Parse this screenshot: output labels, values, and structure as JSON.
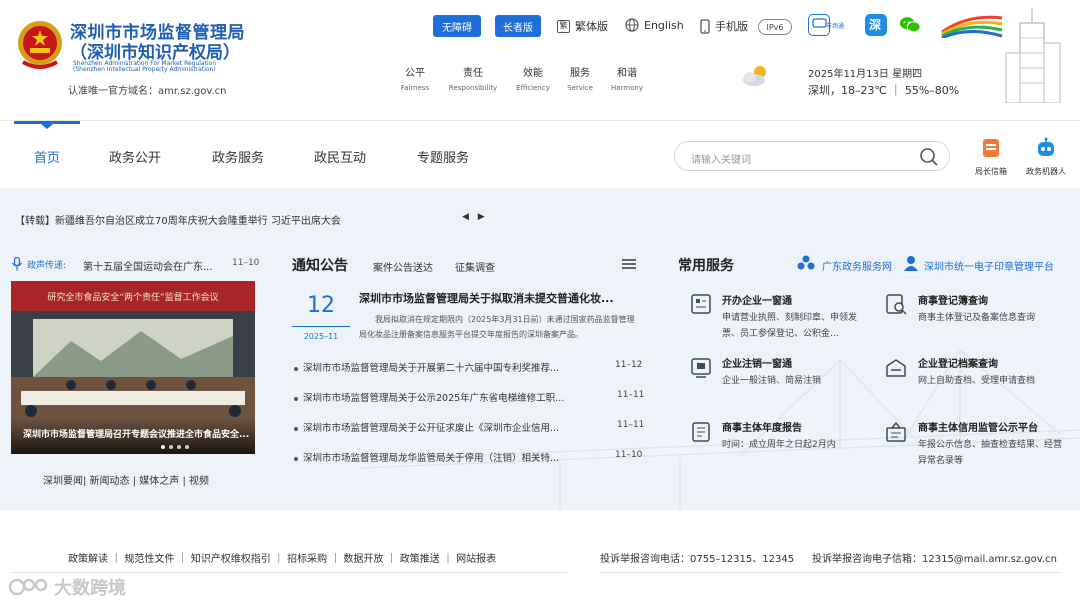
{
  "header": {
    "logo_line1": "深圳市市场监督管理局",
    "logo_line2": "（深圳市知识产权局）",
    "logo_en1": "Shenzhen Administration For Market Regulation",
    "logo_en2": "(Shenzhen Intellectual Property Administration)",
    "official_site": "认准唯一官方域名：amr.sz.gov.cn",
    "accessibility": "无障碍",
    "elder": "长者版",
    "traditional": "繁体版",
    "english": "English",
    "mobile": "手机版",
    "ipv6": "IPv6",
    "app_label": "市场通",
    "values": [
      {
        "cn": "公平",
        "en": "Fairness"
      },
      {
        "cn": "责任",
        "en": "Responsibility"
      },
      {
        "cn": "效能",
        "en": "Efficiency"
      },
      {
        "cn": "服务",
        "en": "Service"
      },
      {
        "cn": "和谐",
        "en": "Harmony"
      }
    ],
    "date": "2025年11月13日 星期四",
    "weather": "深圳，18–23℃  ｜ 55%–80%",
    "brand_colors": {
      "primary": "#1e6fd9",
      "logo": "#1f5fb3"
    }
  },
  "nav": {
    "items": [
      "首页",
      "政务公开",
      "政务服务",
      "政民互动",
      "专题服务"
    ],
    "search_placeholder": "请输入关键词",
    "mailbox": "局长信箱",
    "robot": "政务机器人"
  },
  "ticker": {
    "text": "【转载】新疆维吾尔自治区成立70周年庆祝大会隆重举行 习近平出席大会",
    "arrows": "◀ ▶"
  },
  "news": {
    "label": "政声传递:",
    "headline": "第十五届全国运动会在广东...",
    "date": "11–10",
    "photo_banner": "研究全市食品安全“两个责任”监督工作会议",
    "photo_caption": "深圳市市场监督管理局召开专题会议推进全市食品安全...",
    "links": "深圳要闻| 新闻动态 | 媒体之声 | 视频"
  },
  "notices": {
    "title": "通知公告",
    "tabs": [
      "案件公告送达",
      "征集调查"
    ],
    "featured": {
      "day": "12",
      "year_month": "2025–11",
      "title": "深圳市市场监督管理局关于拟取消未提交普通化妆...",
      "desc": "我局拟取消在规定期限内（2025年3月31日前）未通过国家药品监督管理局化妆品注册备案信息服务平台提交年度报告的深圳备案产品。"
    },
    "items": [
      {
        "title": "深圳市市场监督管理局关于开展第二十六届中国专利奖推荐...",
        "date": "11–12"
      },
      {
        "title": "深圳市市场监督管理局关于公示2025年广东省电梯维修工职...",
        "date": "11–11"
      },
      {
        "title": "深圳市市场监督管理局关于公开征求废止《深圳市企业信用...",
        "date": "11–11"
      },
      {
        "title": "深圳市市场监督管理局龙华监管局关于停用（注销）相关特...",
        "date": "11–10"
      }
    ]
  },
  "services": {
    "title": "常用服务",
    "link1": "广东政务服务网",
    "link2": "深圳市统一电子印章管理平台",
    "items": [
      {
        "title": "开办企业一窗通",
        "desc": "申请营业执照、刻制印章、申领发票、员工参保登记、公积金..."
      },
      {
        "title": "商事登记簿查询",
        "desc": "商事主体登记及备案信息查询"
      },
      {
        "title": "企业注销一窗通",
        "desc": "企业一般注销、简易注销"
      },
      {
        "title": "企业登记档案查询",
        "desc": "网上自助查档、受理申请查档"
      },
      {
        "title": "商事主体年度报告",
        "desc": "时间：成立周年之日起2月内"
      },
      {
        "title": "商事主体信用监管公示平台",
        "desc": "年报公示信息、抽查检查结果、经营异常名录等"
      }
    ]
  },
  "footer": {
    "links": "政策解读  ｜  规范性文件  ｜  知识产权维权指引  ｜  招标采购  ｜  数据开放  ｜  政策推送  ｜  网站报表",
    "phone": "投诉举报咨询电话：0755–12315、12345",
    "mail": "投诉举报咨询电子信箱：12315@mail.amr.sz.gov.cn"
  },
  "watermark": "大数跨境"
}
